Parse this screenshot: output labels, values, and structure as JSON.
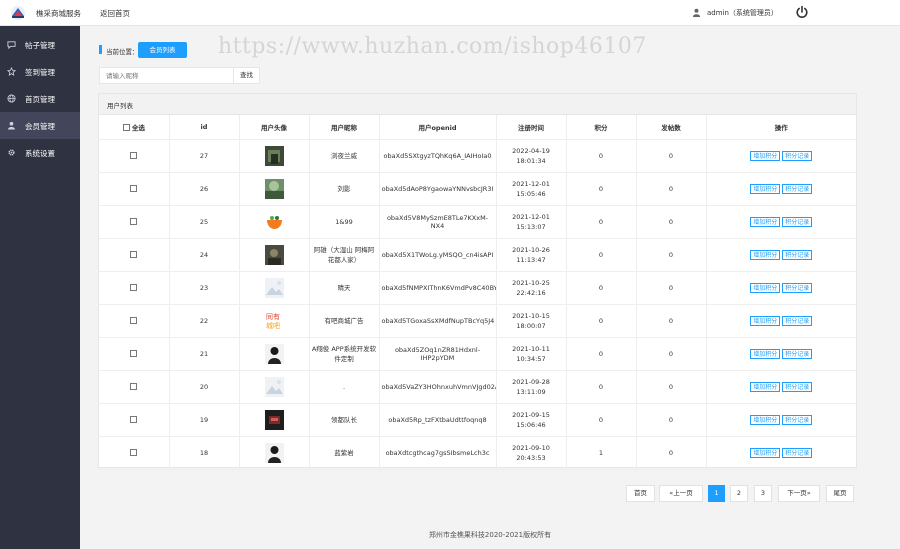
{
  "topbar": {
    "app_title": "樵采商城服务",
    "back_home": "返回首页",
    "user": "admin（系统管理员）"
  },
  "watermark": "https://www.huzhan.com/ishop46107",
  "sidebar": {
    "items": [
      {
        "label": "帖子管理",
        "icon": "comment-icon",
        "active": false
      },
      {
        "label": "签到管理",
        "icon": "star-icon",
        "active": false
      },
      {
        "label": "首页管理",
        "icon": "globe-icon",
        "active": false
      },
      {
        "label": "会员管理",
        "icon": "user-icon",
        "active": true
      },
      {
        "label": "系统设置",
        "icon": "gear-icon",
        "active": false
      }
    ]
  },
  "breadcrumb": {
    "label": "当前位置：",
    "current": "会员列表"
  },
  "search": {
    "placeholder": "请输入昵称",
    "button": "查找"
  },
  "panel": {
    "title": "用户列表"
  },
  "table": {
    "headers": {
      "select_all": "全选",
      "id": "id",
      "avatar": "用户头像",
      "nickname": "用户昵称",
      "openid": "用户openid",
      "register_time": "注册时间",
      "points": "积分",
      "posts": "发帖数",
      "ops": "操作"
    },
    "op_labels": {
      "adjust": "增加积分",
      "records": "积分记录"
    },
    "rows": [
      {
        "id": "27",
        "nickname": "浏夜兰威",
        "openid": "obaXd5SXtgyzTQhKq6A_IAIHoIa0",
        "date": "2022-04-19",
        "time": "18:01:34",
        "points": "0",
        "posts": "0",
        "avatar": "photo-dark-green"
      },
      {
        "id": "26",
        "nickname": "刘影",
        "openid": "obaXd5dAoP8YgaowaYNNvsbcJR3I",
        "date": "2021-12-01",
        "time": "15:05:46",
        "points": "0",
        "posts": "0",
        "avatar": "photo-green"
      },
      {
        "id": "25",
        "nickname": "1&99",
        "openid": "obaXd5V8MySzmE8TLe7KXxM-NX4",
        "date": "2021-12-01",
        "time": "15:13:07",
        "points": "0",
        "posts": "0",
        "avatar": "fruit-bowl"
      },
      {
        "id": "24",
        "nickname": "阿雄（大湿山 阿梅阿 花都人家）",
        "openid": "obaXd5X1TWoLg.yMSQO_cn4isAPI",
        "date": "2021-10-26",
        "time": "11:13:47",
        "points": "0",
        "posts": "0",
        "avatar": "photo-dark"
      },
      {
        "id": "23",
        "nickname": "晴天",
        "openid": "obaXd5fNMPXIThnK6VmdPv8C40BY",
        "date": "2021-10-25",
        "time": "22:42:16",
        "points": "0",
        "posts": "0",
        "avatar": "placeholder"
      },
      {
        "id": "22",
        "nickname": "有吧商城广告",
        "openid": "obaXd5TGoxaSsXMdfNupTBcYq5J4",
        "date": "2021-10-15",
        "time": "18:00:07",
        "points": "0",
        "posts": "0",
        "avatar": "ad-logo"
      },
      {
        "id": "21",
        "nickname": "A翔俊 APP系统开发软件定制",
        "openid": "obaXd5ZOq1nZR81Hdxnl-IHP2pYDM",
        "date": "2021-10-11",
        "time": "10:34:57",
        "points": "0",
        "posts": "0",
        "avatar": "photo-person"
      },
      {
        "id": "20",
        "nickname": ".",
        "openid": "obaXd5VaZY3HOhnxuhVmnVJgd02A",
        "date": "2021-09-28",
        "time": "13:11:09",
        "points": "0",
        "posts": "0",
        "avatar": "placeholder"
      },
      {
        "id": "19",
        "nickname": "领都队长",
        "openid": "obaXd5Rp_tzFXtbaUdttfoqnq8",
        "date": "2021-09-15",
        "time": "15:06:46",
        "points": "0",
        "posts": "0",
        "avatar": "photo-dark-red"
      },
      {
        "id": "18",
        "nickname": "蓝紫岩",
        "openid": "obaXdtcgthcag7gsSIbsmeLch3c",
        "date": "2021-09-10",
        "time": "20:43:53",
        "points": "1",
        "posts": "0",
        "avatar": "photo-person"
      }
    ]
  },
  "pagination": {
    "first": "首页",
    "prev": "«上一页",
    "pages": [
      "1",
      "2",
      "3"
    ],
    "current": "1",
    "next": "下一页»",
    "last": "尾页"
  },
  "footer": "郑州市金樵果科技2020-2021版权所有",
  "colors": {
    "accent": "#1e9fff",
    "sidebar": "#2f3241",
    "sidebar_active": "#43465a"
  }
}
